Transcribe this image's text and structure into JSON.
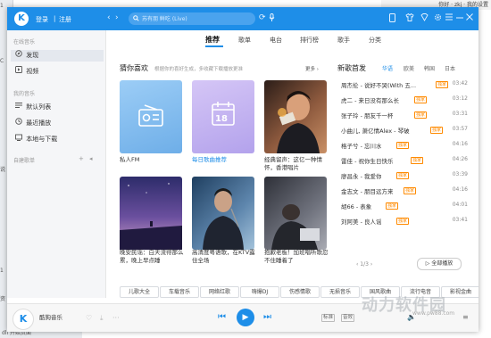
{
  "background": {
    "top_right": "你好 · zkj · 我的设置",
    "left_labels": [
      "1",
      "C",
      "说",
      "1",
      "资"
    ],
    "bottom_left": "dll 开始页面"
  },
  "header": {
    "logo": "K",
    "login": "登录",
    "separator": "|",
    "register": "注册",
    "back_icon": "‹",
    "forward_icon": "›",
    "refresh_icon": "⟳",
    "search_placeholder": "苏有朋 鲜吃 (Live)",
    "search_icon": "search-icon",
    "mic_icon": "microphone-icon",
    "icons": [
      "phone-icon",
      "skin-icon",
      "gift-icon",
      "settings-icon",
      "menu-icon",
      "minimize-icon",
      "maximize-icon",
      "close-icon"
    ]
  },
  "sidebar": {
    "online_section": "在线音乐",
    "items_online": [
      {
        "icon": "discover-icon",
        "label": "发现"
      },
      {
        "icon": "video-icon",
        "label": "视频"
      }
    ],
    "my_section": "我的音乐",
    "items_my": [
      {
        "icon": "list-icon",
        "label": "默认列表"
      },
      {
        "icon": "recent-icon",
        "label": "最近播放"
      },
      {
        "icon": "download-icon",
        "label": "本地与下载"
      }
    ],
    "created_section": "自建歌单"
  },
  "tabs": [
    "推荐",
    "歌单",
    "电台",
    "排行榜",
    "歌手",
    "分类"
  ],
  "main": {
    "guess_title": "猜你喜欢",
    "guess_subtitle": "根据你的喜好生成，多收藏下载播放更准",
    "more": "更多 ›",
    "cards": [
      {
        "title": "私人FM",
        "color": "#8cc3f2"
      },
      {
        "title": "每日歌曲推荐",
        "color": "#c8b8f0",
        "date": "18"
      },
      {
        "title": "经典留声：这亿一种情怀，香港唱片",
        "color": "#7a4b3a"
      },
      {
        "title": "晚安民谣：白天流得那么累，晚上早点睡",
        "color": "#5b4a8a"
      },
      {
        "title": "高清度粤语歌，在KTV露住全场",
        "color": "#3d5f82"
      },
      {
        "title": "抱歉老板！加班唱听歌忍不住睡着了",
        "color": "#4a4e58"
      }
    ]
  },
  "new_songs": {
    "title": "新歌首发",
    "tabs": [
      "华语",
      "欧美",
      "韩国",
      "日本"
    ],
    "rows": [
      {
        "name": "周杰伦 - 说好不哭(With 五...",
        "badge": "独家",
        "time": "03:42"
      },
      {
        "name": "虎二 - 来日没有那么长",
        "badge": "独家",
        "time": "03:12"
      },
      {
        "name": "张子玲 - 朋友千一杯",
        "badge": "独家",
        "time": "03:31"
      },
      {
        "name": "小曲儿, 萧亿情Alex - 琴破",
        "badge": "独家",
        "time": "03:57"
      },
      {
        "name": "格子兮 - 忘川水",
        "badge": "独家",
        "time": "04:16"
      },
      {
        "name": "雷佳 - 祝你生日快乐",
        "badge": "独家",
        "time": "04:26"
      },
      {
        "name": "廖昌永 - 我爱你",
        "badge": "独家",
        "time": "03:39"
      },
      {
        "name": "金志文 - 朋目远方来",
        "badge": "独家",
        "time": "04:16"
      },
      {
        "name": "胡66 - 表象",
        "badge": "独家",
        "time": "04:01"
      },
      {
        "name": "刘阿美 - 良人谣",
        "badge": "独家",
        "time": "03:41"
      }
    ],
    "pager": "‹  1/3  ›",
    "play_all": "▷  全部播放"
  },
  "genres": [
    "儿歌大全",
    "车载音乐",
    "网络红歌",
    "嗨爆DJ",
    "伤感情歌",
    "无损音乐",
    "国风歌曲",
    "流行电音",
    "影视金曲"
  ],
  "player": {
    "avatar": "K",
    "name": "酷狗音乐",
    "heart": "♡",
    "download": "⤓",
    "more": "···",
    "prev": "⏮",
    "play": "▶",
    "next": "⏭",
    "quality": "标准",
    "effect": "音效",
    "volume": "🔈",
    "playlist": "≡"
  },
  "watermark": {
    "text": "动力软件园",
    "url": "www.pw88.com"
  },
  "colors": {
    "accent": "#1e8ee8",
    "badge": "#ff8a00"
  }
}
